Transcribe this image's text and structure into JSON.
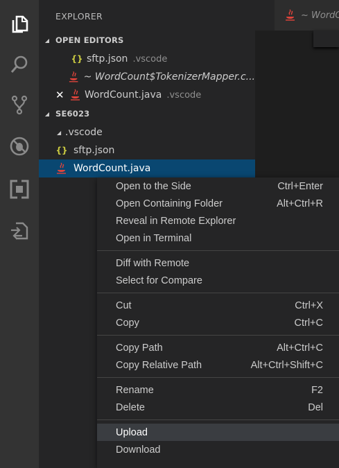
{
  "activity_bar": {
    "items": [
      {
        "name": "explorer",
        "icon": "files-icon",
        "active": true
      },
      {
        "name": "search",
        "icon": "search-icon"
      },
      {
        "name": "source-control",
        "icon": "source-control-icon"
      },
      {
        "name": "debug",
        "icon": "debug-icon"
      },
      {
        "name": "extensions",
        "icon": "extensions-icon"
      },
      {
        "name": "remote",
        "icon": "remote-transfer-icon"
      }
    ]
  },
  "sidebar": {
    "title": "EXPLORER",
    "open_editors": {
      "header": "OPEN EDITORS",
      "items": [
        {
          "name": "sftp.json",
          "desc": ".vscode",
          "icon": "json-icon"
        },
        {
          "name": "~ WordCount$TokenizerMapper.c...",
          "desc": "",
          "icon": "java-icon"
        },
        {
          "name": "WordCount.java",
          "desc": ".vscode",
          "icon": "close-icon"
        }
      ]
    },
    "folder": {
      "header": "SE6023",
      "items": [
        {
          "name": ".vscode"
        },
        {
          "name": "sftp.json"
        },
        {
          "name": "WordCount.java"
        }
      ]
    }
  },
  "editor": {
    "tab_label": "~ WordC"
  },
  "context_menu": {
    "groups": [
      [
        {
          "label": "Open to the Side",
          "shortcut": "Ctrl+Enter"
        },
        {
          "label": "Open Containing Folder",
          "shortcut": "Alt+Ctrl+R"
        },
        {
          "label": "Reveal in Remote Explorer",
          "shortcut": ""
        },
        {
          "label": "Open in Terminal",
          "shortcut": ""
        }
      ],
      [
        {
          "label": "Diff with Remote",
          "shortcut": ""
        },
        {
          "label": "Select for Compare",
          "shortcut": ""
        }
      ],
      [
        {
          "label": "Cut",
          "shortcut": "Ctrl+X"
        },
        {
          "label": "Copy",
          "shortcut": "Ctrl+C"
        }
      ],
      [
        {
          "label": "Copy Path",
          "shortcut": "Alt+Ctrl+C"
        },
        {
          "label": "Copy Relative Path",
          "shortcut": "Alt+Ctrl+Shift+C"
        }
      ],
      [
        {
          "label": "Rename",
          "shortcut": "F2"
        },
        {
          "label": "Delete",
          "shortcut": "Del"
        }
      ],
      [
        {
          "label": "Upload",
          "shortcut": "",
          "highlighted": true
        },
        {
          "label": "Download",
          "shortcut": ""
        }
      ]
    ]
  },
  "colors": {
    "activity_bar": "#333333",
    "sidebar": "#252526",
    "selection": "#094771",
    "menu_highlight": "#3a3d41",
    "json_icon": "#cbcb41",
    "java_icon": "#e0443b"
  }
}
